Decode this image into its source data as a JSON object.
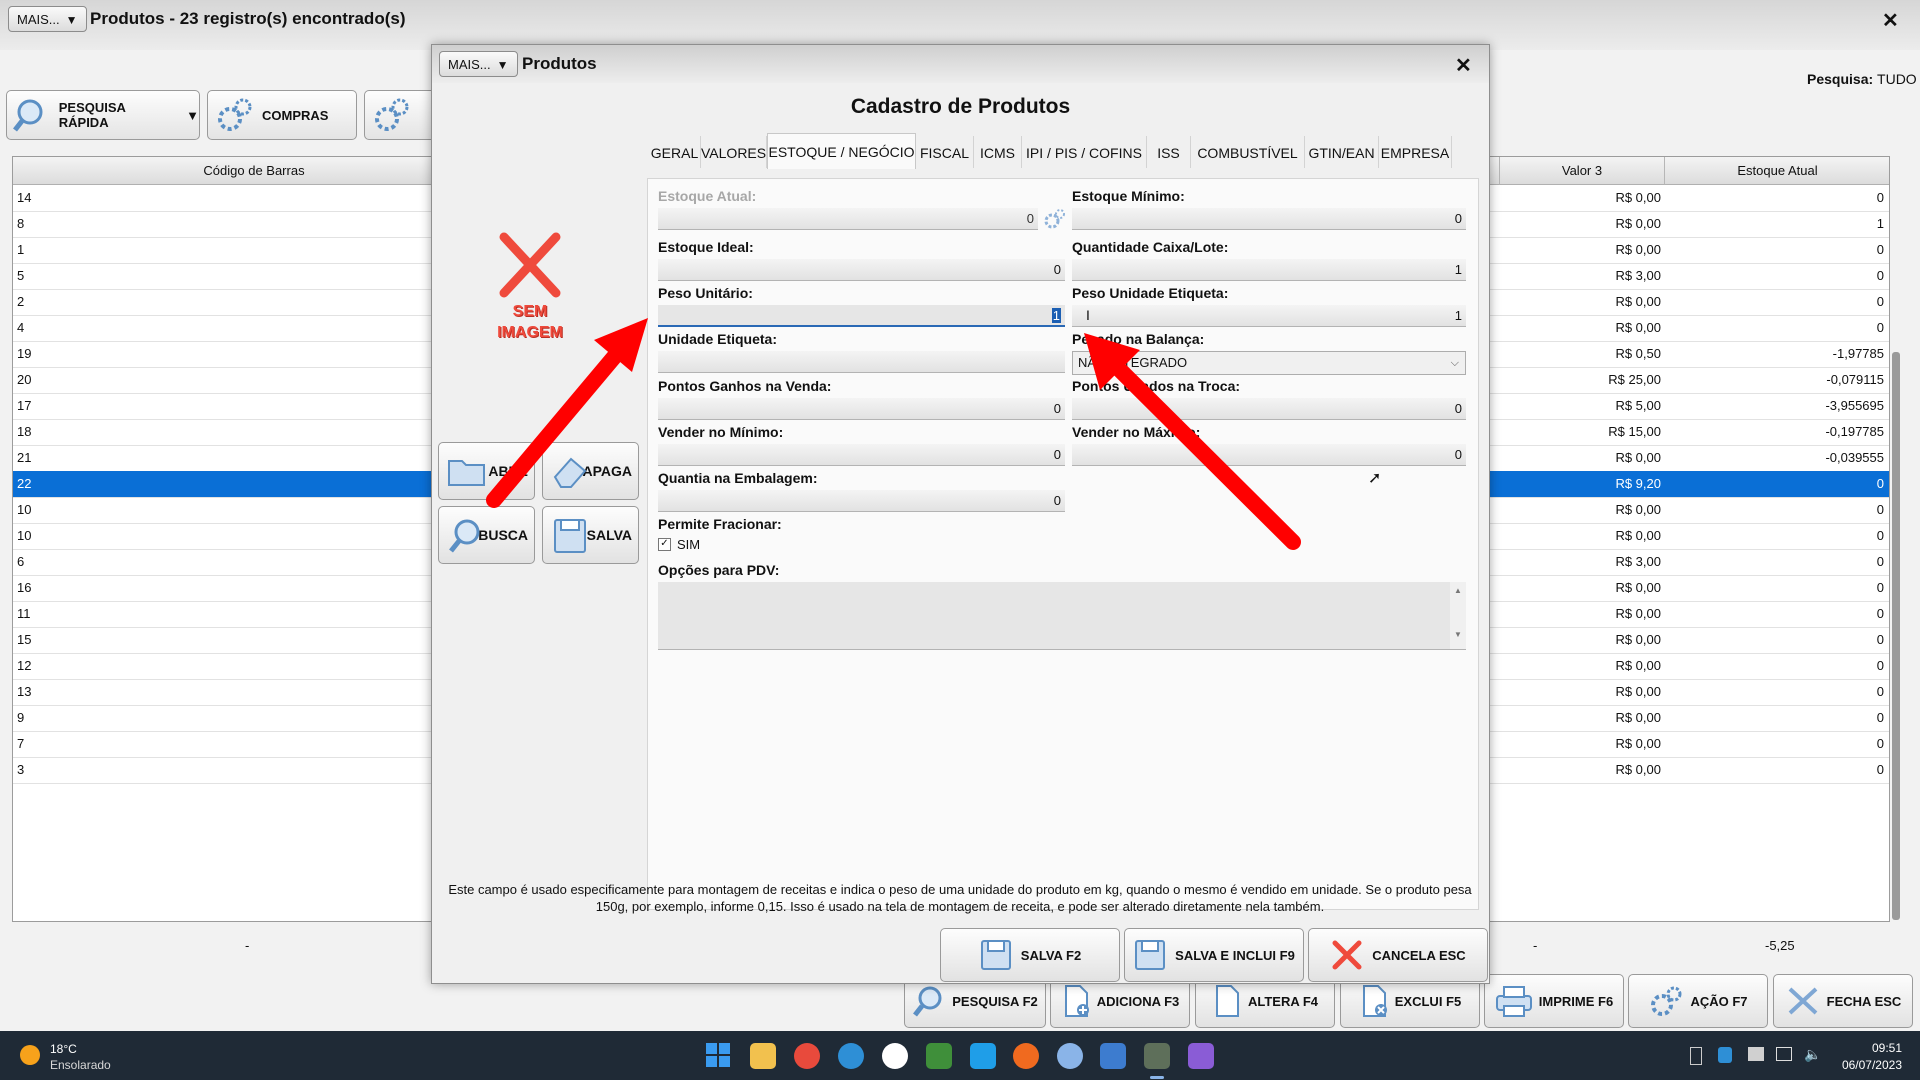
{
  "window": {
    "more_label": "MAIS...",
    "title": "Produtos - 23 registro(s) encontrado(s)",
    "close": "✕"
  },
  "search_status": {
    "label": "Pesquisa:",
    "value": "TUDO"
  },
  "toolbar": {
    "quick_search": "PESQUISA RÁPIDA",
    "purchases": "COMPRAS"
  },
  "grid": {
    "headers": {
      "barcode": "Código de Barras",
      "value3": "Valor 3",
      "stock": "Estoque Atual"
    },
    "rows": [
      {
        "code": "14",
        "value3": "R$ 0,00",
        "stock": "0"
      },
      {
        "code": "8",
        "value3": "R$ 0,00",
        "stock": "1"
      },
      {
        "code": "1",
        "value3": "R$ 0,00",
        "stock": "0"
      },
      {
        "code": "5",
        "value3": "R$ 3,00",
        "stock": "0"
      },
      {
        "code": "2",
        "value3": "R$ 0,00",
        "stock": "0"
      },
      {
        "code": "4",
        "value3": "R$ 0,00",
        "stock": "0"
      },
      {
        "code": "19",
        "value3": "R$ 0,50",
        "stock": "-1,97785"
      },
      {
        "code": "20",
        "value3": "R$ 25,00",
        "stock": "-0,079115"
      },
      {
        "code": "17",
        "value3": "R$ 5,00",
        "stock": "-3,955695"
      },
      {
        "code": "18",
        "value3": "R$ 15,00",
        "stock": "-0,197785"
      },
      {
        "code": "21",
        "value3": "R$ 0,00",
        "stock": "-0,039555"
      },
      {
        "code": "22",
        "value3": "R$ 9,20",
        "stock": "0"
      },
      {
        "code": "10",
        "value3": "R$ 0,00",
        "stock": "0"
      },
      {
        "code": "10",
        "value3": "R$ 0,00",
        "stock": "0"
      },
      {
        "code": "6",
        "value3": "R$ 3,00",
        "stock": "0"
      },
      {
        "code": "16",
        "value3": "R$ 0,00",
        "stock": "0"
      },
      {
        "code": "11",
        "value3": "R$ 0,00",
        "stock": "0"
      },
      {
        "code": "15",
        "value3": "R$ 0,00",
        "stock": "0"
      },
      {
        "code": "12",
        "value3": "R$ 0,00",
        "stock": "0"
      },
      {
        "code": "13",
        "value3": "R$ 0,00",
        "stock": "0"
      },
      {
        "code": "9",
        "value3": "R$ 0,00",
        "stock": "0"
      },
      {
        "code": "7",
        "value3": "R$ 0,00",
        "stock": "0"
      },
      {
        "code": "3",
        "value3": "R$ 0,00",
        "stock": "0"
      }
    ],
    "footer": {
      "col1": "-",
      "col2": "-",
      "total_stock": "-5,25"
    }
  },
  "bottom_buttons": {
    "search": "PESQUISA F2",
    "add": "ADICIONA F3",
    "edit": "ALTERA F4",
    "delete": "EXCLUI F5",
    "print": "IMPRIME F6",
    "action": "AÇÃO F7",
    "close": "FECHA ESC"
  },
  "dialog": {
    "more_label": "MAIS...",
    "title": "Produtos",
    "close": "✕",
    "heading": "Cadastro de Produtos",
    "no_image": "SEM IMAGEM",
    "tabs": [
      "GERAL",
      "VALORES",
      "ESTOQUE / NEGÓCIO",
      "FISCAL",
      "ICMS",
      "IPI / PIS / COFINS",
      "ISS",
      "COMBUSTÍVEL",
      "GTIN/EAN",
      "EMPRESA"
    ],
    "side_buttons": {
      "open": "ABRE",
      "clear": "APAGA",
      "search": "BUSCA",
      "save": "SALVA"
    },
    "fields": {
      "estoque_atual": {
        "label": "Estoque Atual:",
        "value": "0"
      },
      "estoque_minimo": {
        "label": "Estoque Mínimo:",
        "value": "0"
      },
      "estoque_ideal": {
        "label": "Estoque Ideal:",
        "value": "0"
      },
      "qtd_caixa": {
        "label": "Quantidade Caixa/Lote:",
        "value": "1"
      },
      "peso_unitario": {
        "label": "Peso Unitário:",
        "value": "1"
      },
      "peso_etiqueta": {
        "label": "Peso Unidade Etiqueta:",
        "value": "1"
      },
      "unidade_etiqueta": {
        "label": "Unidade Etiqueta:",
        "value": ""
      },
      "pesado_balanca": {
        "label": "Pesado na Balança:",
        "value": "NÃO INTEGRADO"
      },
      "pontos_venda": {
        "label": "Pontos Ganhos na Venda:",
        "value": "0"
      },
      "pontos_troca": {
        "label": "Pontos Usados na Troca:",
        "value": "0"
      },
      "vender_minimo": {
        "label": "Vender no Mínimo:",
        "value": "0"
      },
      "vender_maximo": {
        "label": "Vender no Máximo:",
        "value": "0"
      },
      "quantia_embalagem": {
        "label": "Quantia na Embalagem:",
        "value": "0"
      },
      "permite_fracionar": {
        "label": "Permite Fracionar:",
        "option": "SIM",
        "checked": true
      },
      "opcoes_pdv": {
        "label": "Opções para PDV:"
      }
    },
    "help_text": "Este campo é usado especificamente para montagem de receitas e indica o peso de uma unidade do produto em kg, quando o mesmo é vendido em unidade. Se o produto pesa 150g, por exemplo, informe 0,15. Isso é usado na tela de montagem de receita, e pode ser alterado diretamente nela também.",
    "buttons": {
      "save": "SALVA F2",
      "save_new": "SALVA E INCLUI F9",
      "cancel": "CANCELA ESC"
    }
  },
  "taskbar": {
    "temperature": "18°C",
    "weather": "Ensolarado",
    "time": "09:51",
    "date": "06/07/2023"
  },
  "colors": {
    "selection": "#0a6fd6",
    "arrow": "#ff0000",
    "taskbar": "#1f2a36"
  }
}
